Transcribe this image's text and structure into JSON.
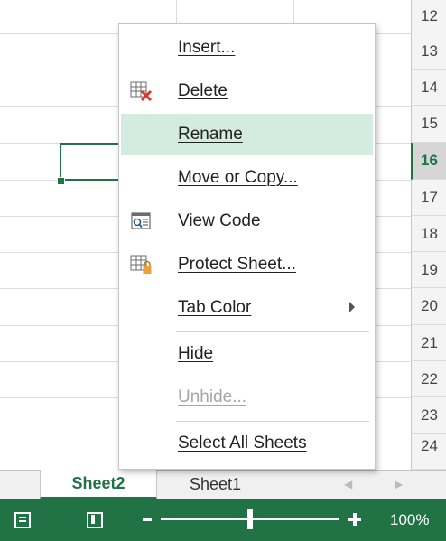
{
  "grid": {
    "row_numbers": [
      "12",
      "13",
      "14",
      "15",
      "16",
      "17",
      "18",
      "19",
      "20",
      "21",
      "22",
      "23",
      "24"
    ],
    "active_row": "16"
  },
  "context_menu": {
    "items": [
      {
        "label": "Insert...",
        "icon": "",
        "state": "normal"
      },
      {
        "label": "Delete",
        "icon": "delete-sheet-icon",
        "state": "normal"
      },
      {
        "label": "Rename",
        "icon": "",
        "state": "highlighted"
      },
      {
        "label": "Move or Copy...",
        "icon": "",
        "state": "normal"
      },
      {
        "label": "View Code",
        "icon": "view-code-icon",
        "state": "normal"
      },
      {
        "label": "Protect Sheet...",
        "icon": "protect-sheet-icon",
        "state": "normal"
      },
      {
        "label": "Tab Color",
        "icon": "",
        "state": "normal",
        "has_submenu": true
      },
      {
        "label": "Hide",
        "icon": "",
        "state": "normal"
      },
      {
        "label": "Unhide...",
        "icon": "",
        "state": "disabled"
      },
      {
        "label": "Select All Sheets",
        "icon": "",
        "state": "normal"
      }
    ]
  },
  "sheet_tabs": {
    "active": "Sheet2",
    "inactive": "Sheet1"
  },
  "status_bar": {
    "zoom_level": "100%",
    "zoom_fraction": 0.5
  },
  "colors": {
    "accent": "#217346",
    "menu_highlight": "#d3ecdf",
    "disabled_text": "#a6a6a6",
    "delete_x": "#e0352b",
    "lock": "#e8a33a"
  }
}
